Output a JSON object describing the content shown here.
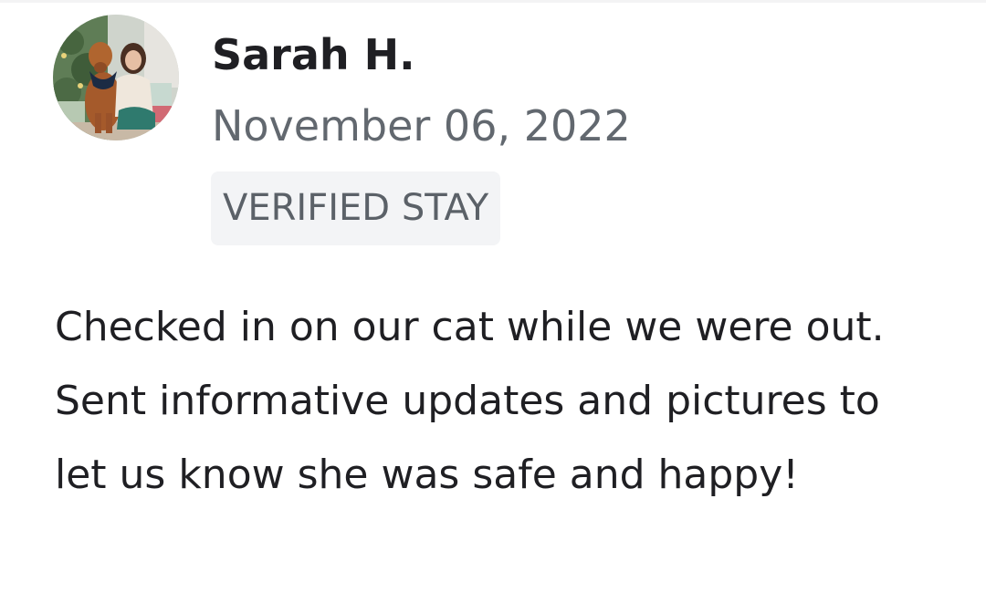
{
  "review": {
    "reviewer_name": "Sarah H.",
    "date": "November 06, 2022",
    "badge": "VERIFIED STAY",
    "text": "Checked in on our cat while we were out. Sent informative updates and pictures to let us know she was safe and happy!"
  },
  "colors": {
    "name": "#1f1f23",
    "date": "#62686f",
    "badge_bg": "#f3f4f6",
    "badge_text": "#5b6168",
    "body_text": "#1f1f23"
  },
  "icons": {
    "avatar": "reviewer-photo-woman-with-dog"
  }
}
